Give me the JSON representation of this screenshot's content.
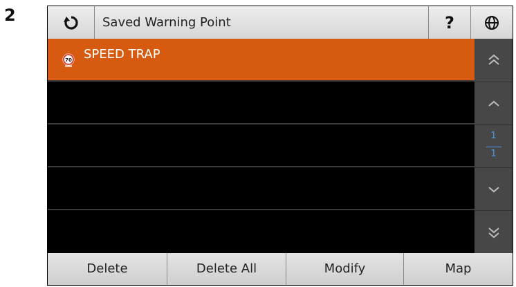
{
  "step_number": "2",
  "header": {
    "title": "Saved Warning Point",
    "help_label": "?",
    "refresh_icon": "refresh-icon",
    "globe_icon": "globe-icon"
  },
  "list": {
    "items": [
      {
        "label": "SPEED TRAP",
        "icon": "speed-limit-70-icon",
        "icon_text": "70",
        "selected": true
      },
      {
        "label": ""
      },
      {
        "label": ""
      },
      {
        "label": ""
      },
      {
        "label": ""
      }
    ]
  },
  "scroll": {
    "current_page": "1",
    "total_pages": "1",
    "icons": [
      "double-chevron-up-icon",
      "chevron-up-icon",
      "chevron-down-icon",
      "double-chevron-down-icon"
    ]
  },
  "bottom_bar": {
    "buttons": [
      "Delete",
      "Delete All",
      "Modify",
      "Map"
    ]
  },
  "colors": {
    "selected_row": "#d65b10",
    "page_indicator": "#4a9be8",
    "scroll_bg": "#474747"
  }
}
